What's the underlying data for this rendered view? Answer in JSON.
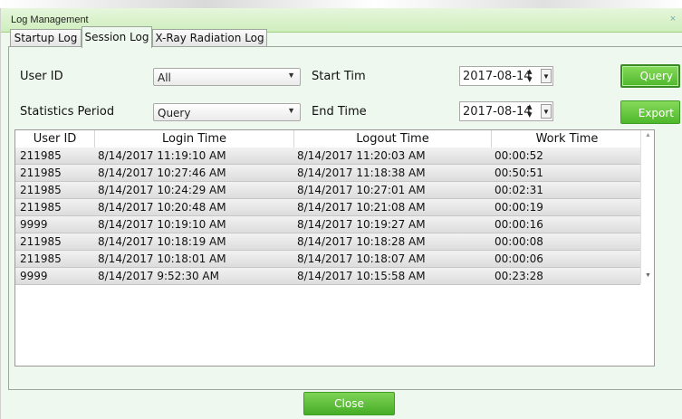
{
  "window": {
    "title": "Log Management",
    "close_glyph": "×"
  },
  "tabs": [
    {
      "label": "Startup Log",
      "active": false
    },
    {
      "label": "Session Log",
      "active": true
    },
    {
      "label": "X-Ray Radiation Log",
      "active": false
    }
  ],
  "filters": {
    "user_id_label": "User ID",
    "user_id_value": "All",
    "period_label": "Statistics Period",
    "period_value": "Query",
    "start_label": "Start Tim",
    "start_value": "2017-08-14",
    "end_label": "End Time",
    "end_value": "2017-08-14",
    "query_button": "Query",
    "export_button": "Export"
  },
  "grid": {
    "columns": [
      "User ID",
      "Login Time",
      "Logout Time",
      "Work Time"
    ],
    "rows": [
      [
        "211985",
        "8/14/2017 11:19:10 AM",
        "8/14/2017 11:20:03 AM",
        "00:00:52"
      ],
      [
        "211985",
        "8/14/2017 10:27:46 AM",
        "8/14/2017 11:18:38 AM",
        "00:50:51"
      ],
      [
        "211985",
        "8/14/2017 10:24:29 AM",
        "8/14/2017 10:27:01 AM",
        "00:02:31"
      ],
      [
        "211985",
        "8/14/2017 10:20:48 AM",
        "8/14/2017 10:21:08 AM",
        "00:00:19"
      ],
      [
        "9999",
        "8/14/2017 10:19:10 AM",
        "8/14/2017 10:19:27 AM",
        "00:00:16"
      ],
      [
        "211985",
        "8/14/2017 10:18:19 AM",
        "8/14/2017 10:18:28 AM",
        "00:00:08"
      ],
      [
        "211985",
        "8/14/2017 10:18:01 AM",
        "8/14/2017 10:18:07 AM",
        "00:00:06"
      ],
      [
        "9999",
        "8/14/2017 9:52:30 AM",
        "8/14/2017 10:15:58 AM",
        "00:23:28"
      ]
    ]
  },
  "footer": {
    "close_button": "Close"
  },
  "colors": {
    "accent_green": "#4fb82c",
    "window_bg": "#eef8ee"
  }
}
